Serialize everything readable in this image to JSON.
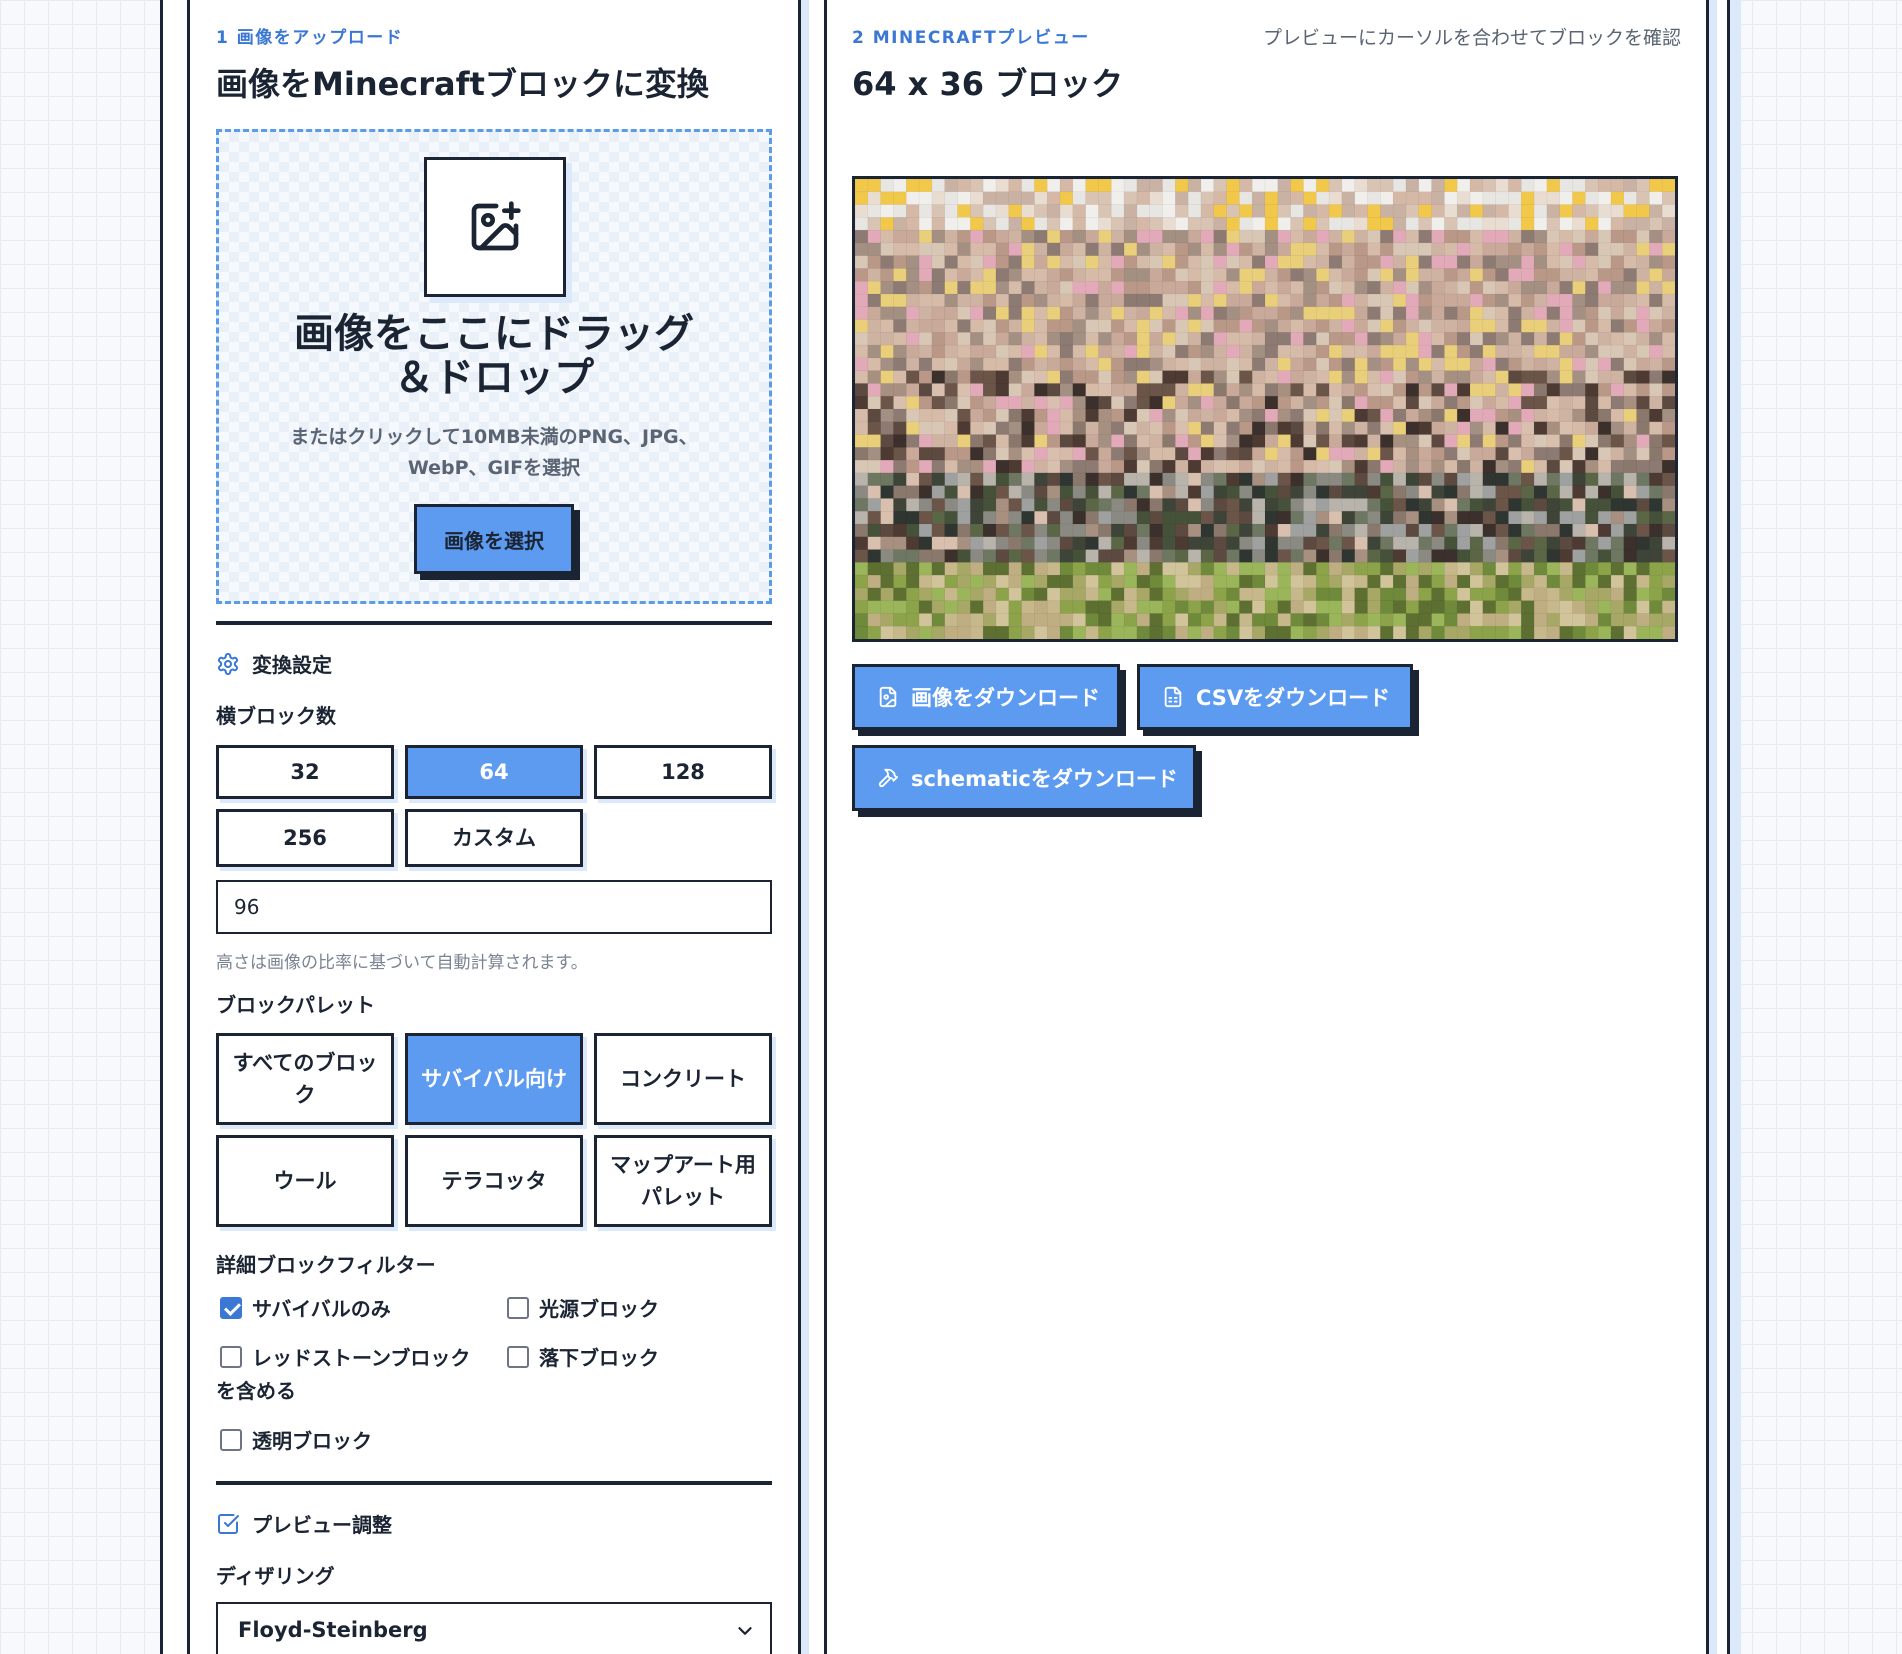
{
  "upload": {
    "step_label": "1 画像をアップロード",
    "title": "画像をMinecraftブロックに変換",
    "drop_title": "画像をここにドラッグ＆ドロップ",
    "drop_sub": "またはクリックして10MB未満のPNG、JPG、WebP、GIFを選択",
    "select_button": "画像を選択"
  },
  "settings": {
    "heading": "変換設定",
    "width_label": "横ブロック数",
    "width_options": [
      "32",
      "64",
      "128",
      "256",
      "カスタム"
    ],
    "width_selected": "64",
    "custom_width_value": "96",
    "height_help": "高さは画像の比率に基づいて自動計算されます。",
    "palette_label": "ブロックパレット",
    "palette_options": [
      "すべてのブロック",
      "サバイバル向け",
      "コンクリート",
      "ウール",
      "テラコッタ",
      "マップアート用パレット"
    ],
    "palette_selected": "サバイバル向け",
    "filter_label": "詳細ブロックフィルター",
    "filters": [
      {
        "label": "サバイバルのみ",
        "checked": true
      },
      {
        "label": "光源ブロック",
        "checked": false
      },
      {
        "label": "レッドストーンブロックを含める",
        "checked": false
      },
      {
        "label": "落下ブロック",
        "checked": false
      },
      {
        "label": "透明ブロック",
        "checked": false
      }
    ]
  },
  "preview_adjust": {
    "heading": "プレビュー調整",
    "dither_label": "ディザリング",
    "dither_value": "Floyd-Steinberg"
  },
  "preview": {
    "step_label": "2 MINECRAFTプレビュー",
    "hint": "プレビューにカーソルを合わせてブロックを確認",
    "title": "64 x 36 ブロック",
    "grid_cols": 64,
    "grid_rows": 36,
    "download_image": "画像をダウンロード",
    "download_csv": "CSVをダウンロード",
    "download_schematic": "schematicをダウンロード"
  },
  "colors": {
    "accent": "#5c9bf0",
    "accent_dark": "#3a78d4",
    "ink": "#1b2433"
  }
}
